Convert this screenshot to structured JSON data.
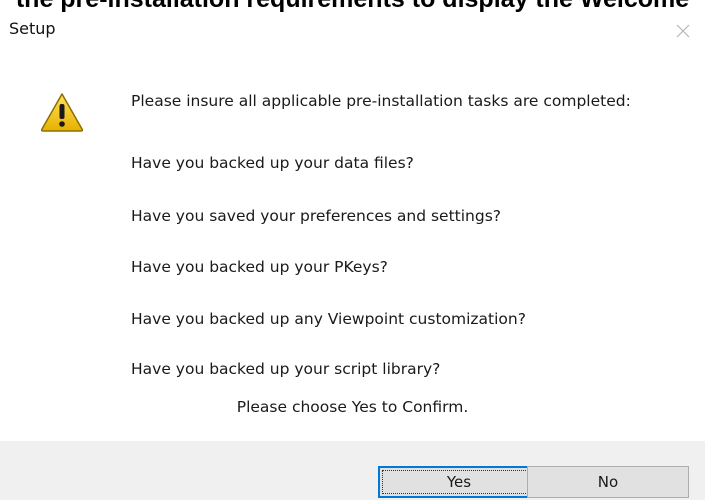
{
  "caption": "the pre-installation requirements to display the Welcome",
  "window": {
    "title": "Setup",
    "close_label": "Close"
  },
  "message": {
    "icon": "warning-icon",
    "intro": "Please insure all applicable pre-installation tasks are completed:",
    "questions": [
      "Have you backed up your data files?",
      "Have you saved your preferences and settings?",
      "Have you backed up your PKeys?",
      "Have you backed up any Viewpoint customization?",
      "Have you backed up your script library?"
    ],
    "confirm": "Please choose Yes to Confirm."
  },
  "buttons": {
    "yes_label": "Yes",
    "no_label": "No"
  },
  "colors": {
    "warning_fill": "#f5c400",
    "warning_outline": "#8a7000",
    "default_button_border": "#0078d7",
    "footer_bg": "#f0f0f0"
  }
}
